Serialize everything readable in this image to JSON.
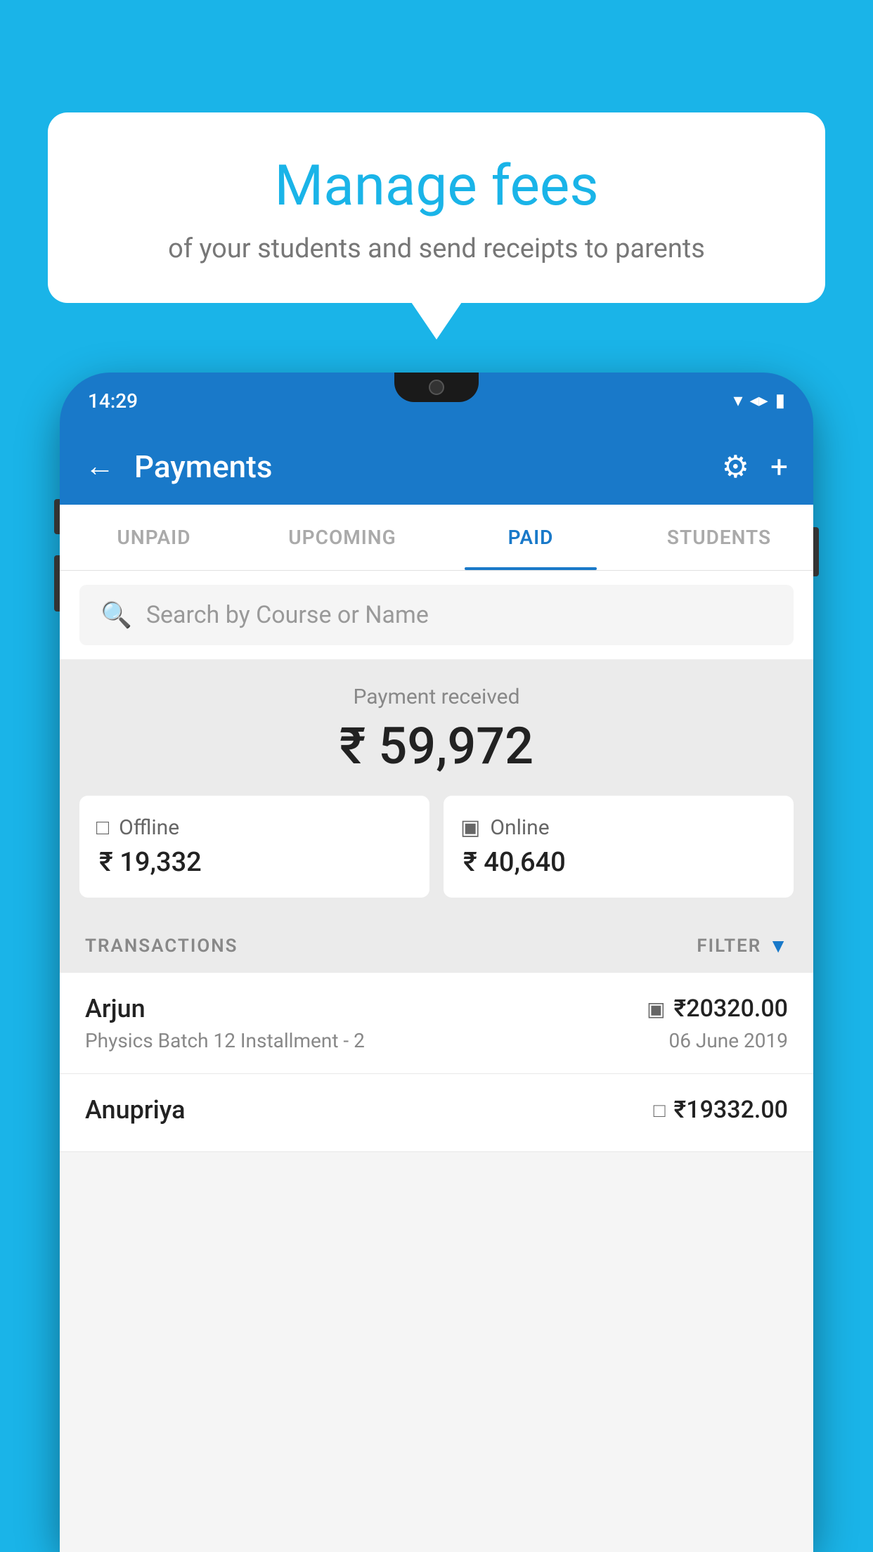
{
  "page": {
    "background_color": "#1ab4e8"
  },
  "speech_bubble": {
    "title": "Manage fees",
    "subtitle": "of your students and send receipts to parents"
  },
  "phone": {
    "status_bar": {
      "time": "14:29",
      "wifi_icon": "▼",
      "signal_icon": "▲",
      "battery_icon": "▮"
    },
    "header": {
      "back_label": "←",
      "title": "Payments",
      "settings_label": "⚙",
      "add_label": "+"
    },
    "tabs": [
      {
        "label": "UNPAID",
        "active": false
      },
      {
        "label": "UPCOMING",
        "active": false
      },
      {
        "label": "PAID",
        "active": true
      },
      {
        "label": "STUDENTS",
        "active": false
      }
    ],
    "search": {
      "placeholder": "Search by Course or Name"
    },
    "payment_summary": {
      "label": "Payment received",
      "amount": "₹ 59,972",
      "offline": {
        "icon": "💳",
        "label": "Offline",
        "amount": "₹ 19,332"
      },
      "online": {
        "icon": "💳",
        "label": "Online",
        "amount": "₹ 40,640"
      }
    },
    "transactions_header": {
      "label": "TRANSACTIONS",
      "filter_label": "FILTER"
    },
    "transactions": [
      {
        "name": "Arjun",
        "type_icon": "💳",
        "amount": "₹20320.00",
        "description": "Physics Batch 12 Installment - 2",
        "date": "06 June 2019"
      },
      {
        "name": "Anupriya",
        "type_icon": "₹",
        "amount": "₹19332.00",
        "description": "",
        "date": ""
      }
    ]
  }
}
